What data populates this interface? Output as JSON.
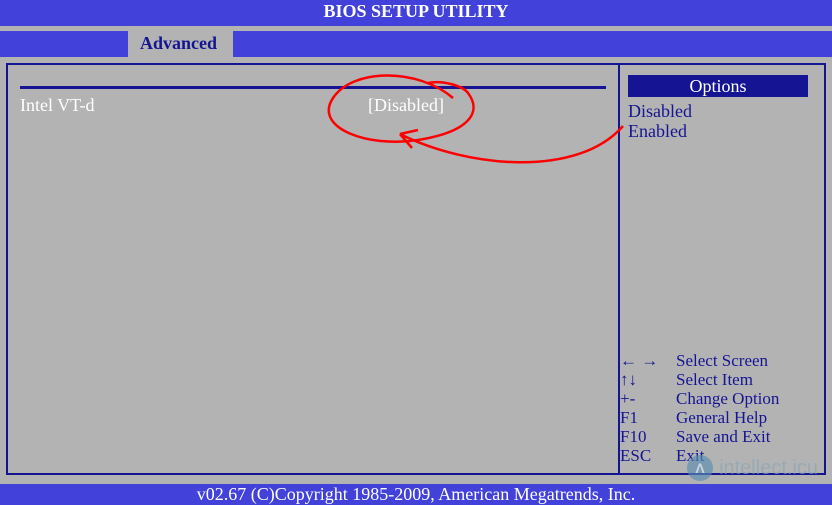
{
  "header": {
    "title": "BIOS SETUP UTILITY"
  },
  "tabs": {
    "active": "Advanced"
  },
  "settings": {
    "item0": {
      "label": "Intel VT-d",
      "value": "[Disabled]"
    }
  },
  "options": {
    "heading": "Options",
    "list": {
      "opt0": "Disabled",
      "opt1": "Enabled"
    }
  },
  "help": {
    "row0": {
      "key": "← →",
      "desc": "Select Screen"
    },
    "row1": {
      "key": "↑↓",
      "desc": "Select Item"
    },
    "row2": {
      "key": "+-",
      "desc": "Change Option"
    },
    "row3": {
      "key": "F1",
      "desc": "General Help"
    },
    "row4": {
      "key": "F10",
      "desc": "Save and Exit"
    },
    "row5": {
      "key": "ESC",
      "desc": "Exit"
    }
  },
  "footer": {
    "text": "v02.67 (C)Copyright 1985-2009, American Megatrends, Inc."
  },
  "watermark": {
    "icon": "Λ",
    "text": "intellect.icu"
  }
}
